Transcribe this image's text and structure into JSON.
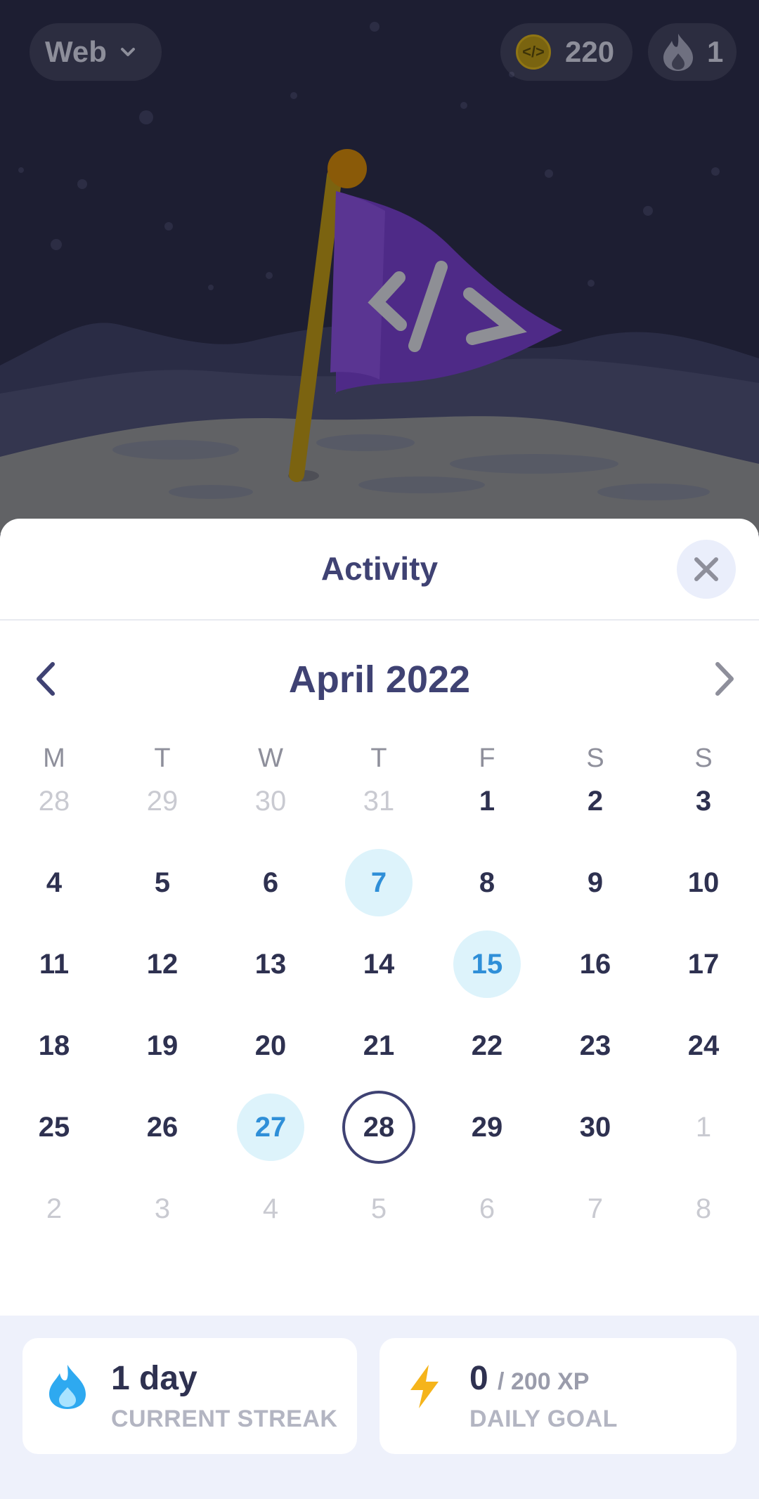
{
  "header": {
    "track_selector": "Web",
    "coins": "220",
    "streak_count": "1"
  },
  "modal": {
    "title": "Activity",
    "month_label": "April 2022",
    "weekdays": [
      "M",
      "T",
      "W",
      "T",
      "F",
      "S",
      "S"
    ],
    "weeks": [
      [
        {
          "d": "28",
          "s": "out"
        },
        {
          "d": "29",
          "s": "out"
        },
        {
          "d": "30",
          "s": "out"
        },
        {
          "d": "31",
          "s": "out"
        },
        {
          "d": "1",
          "s": ""
        },
        {
          "d": "2",
          "s": ""
        },
        {
          "d": "3",
          "s": ""
        }
      ],
      [
        {
          "d": "4",
          "s": ""
        },
        {
          "d": "5",
          "s": ""
        },
        {
          "d": "6",
          "s": ""
        },
        {
          "d": "7",
          "s": "active"
        },
        {
          "d": "8",
          "s": ""
        },
        {
          "d": "9",
          "s": ""
        },
        {
          "d": "10",
          "s": ""
        }
      ],
      [
        {
          "d": "11",
          "s": ""
        },
        {
          "d": "12",
          "s": ""
        },
        {
          "d": "13",
          "s": ""
        },
        {
          "d": "14",
          "s": ""
        },
        {
          "d": "15",
          "s": "active"
        },
        {
          "d": "16",
          "s": ""
        },
        {
          "d": "17",
          "s": ""
        }
      ],
      [
        {
          "d": "18",
          "s": ""
        },
        {
          "d": "19",
          "s": ""
        },
        {
          "d": "20",
          "s": ""
        },
        {
          "d": "21",
          "s": ""
        },
        {
          "d": "22",
          "s": ""
        },
        {
          "d": "23",
          "s": ""
        },
        {
          "d": "24",
          "s": ""
        }
      ],
      [
        {
          "d": "25",
          "s": ""
        },
        {
          "d": "26",
          "s": ""
        },
        {
          "d": "27",
          "s": "active"
        },
        {
          "d": "28",
          "s": "today"
        },
        {
          "d": "29",
          "s": ""
        },
        {
          "d": "30",
          "s": ""
        },
        {
          "d": "1",
          "s": "out"
        }
      ],
      [
        {
          "d": "2",
          "s": "out"
        },
        {
          "d": "3",
          "s": "out"
        },
        {
          "d": "4",
          "s": "out"
        },
        {
          "d": "5",
          "s": "out"
        },
        {
          "d": "6",
          "s": "out"
        },
        {
          "d": "7",
          "s": "out"
        },
        {
          "d": "8",
          "s": "out"
        }
      ]
    ]
  },
  "stats": {
    "streak_value": "1 day",
    "streak_caption": "CURRENT STREAK",
    "goal_value": "0",
    "goal_total": "/ 200 XP",
    "goal_caption": "DAILY GOAL"
  },
  "colors": {
    "active_day_bg": "#ddf3fb",
    "active_day_text": "#2f8fd8",
    "today_ring": "#3f4273",
    "flag": "#5b2e9a"
  },
  "icons": {
    "flag_emblem": "</>"
  }
}
